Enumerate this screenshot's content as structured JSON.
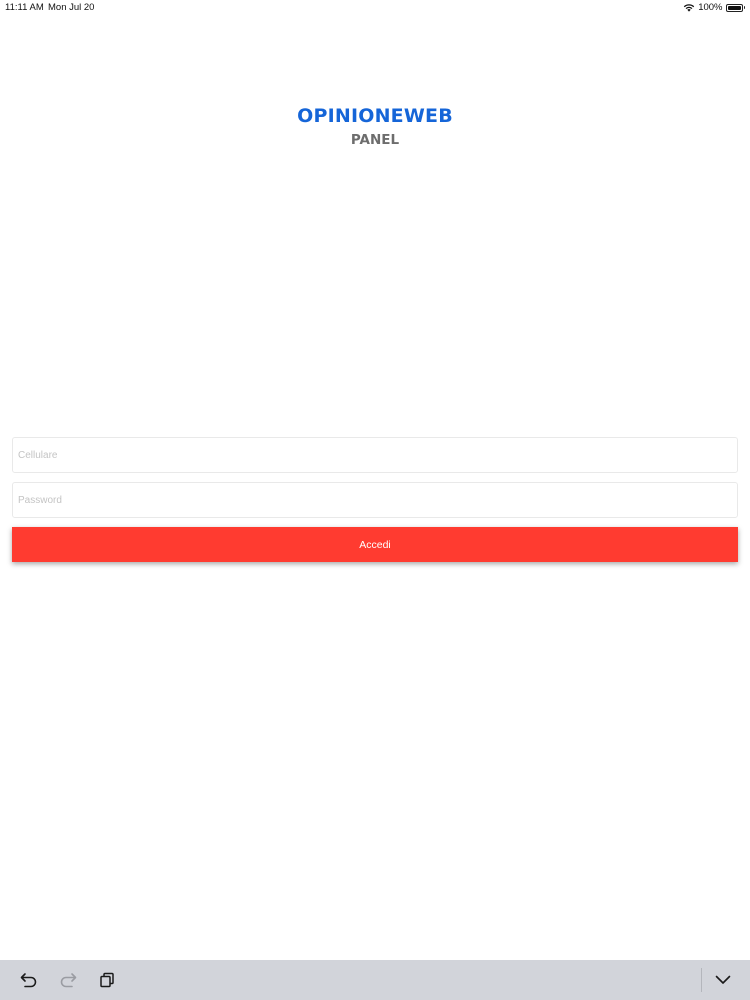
{
  "status_bar": {
    "time": "11:11 AM",
    "date": "Mon Jul 20",
    "battery": "100%",
    "battery_level": 1.0
  },
  "logo": {
    "title": "OPINIONEWEB",
    "subtitle": "PANEL"
  },
  "form": {
    "phone_placeholder": "Cellulare",
    "phone_value": "",
    "password_placeholder": "Password",
    "password_value": "",
    "submit_label": "Accedi"
  },
  "keyboard_bar": {
    "icons": [
      "undo-icon",
      "redo-icon",
      "paste-icon",
      "keyboard-dismiss-icon"
    ]
  },
  "colors": {
    "brand_blue": "#1565d8",
    "subtitle_gray": "#6d6d6d",
    "button_red": "#ff3b30",
    "bar_gray": "#d2d4da"
  }
}
